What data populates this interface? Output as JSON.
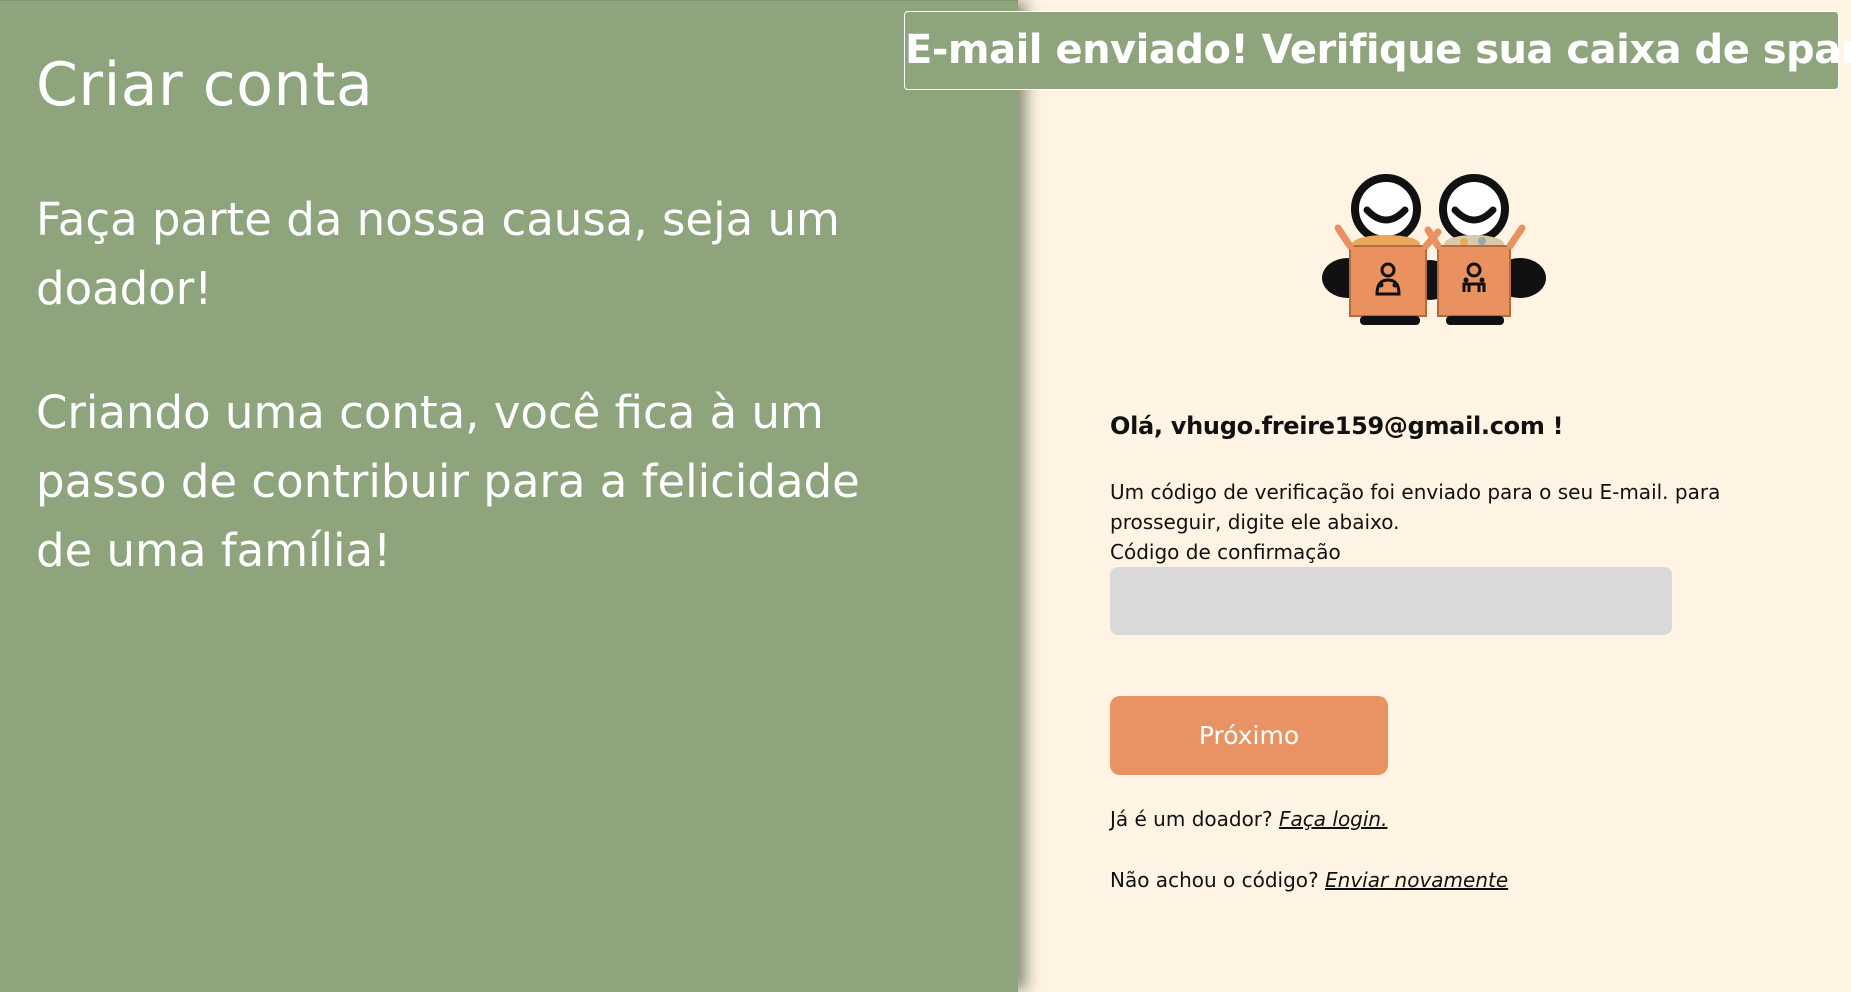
{
  "left": {
    "title": "Criar conta",
    "paragraph_1": "Faça parte da nossa causa, seja um doador!",
    "paragraph_2": "Criando uma conta, você fica à um passo de contribuir para a felicidade de uma família!"
  },
  "toast": {
    "message": "E-mail enviado! Verifique sua caixa de spam."
  },
  "logo": {
    "icon": "two-people-with-donation-boxes-logo"
  },
  "form": {
    "greeting": "Olá, vhugo.freire159@gmail.com !",
    "info": "Um código de verificação foi enviado para o seu E-mail. para prosseguir, digite ele abaixo.",
    "code_label": "Código de confirmação",
    "code_value": "",
    "next_label": "Próximo",
    "login_prompt": "Já é um doador?",
    "login_link": "Faça login.",
    "resend_prompt": "Não achou o código?",
    "resend_link": "Enviar novamente"
  },
  "colors": {
    "green": "#8da47c",
    "cream": "#fff3e3",
    "orange": "#e99364",
    "input_gray": "#d9d9d9"
  }
}
